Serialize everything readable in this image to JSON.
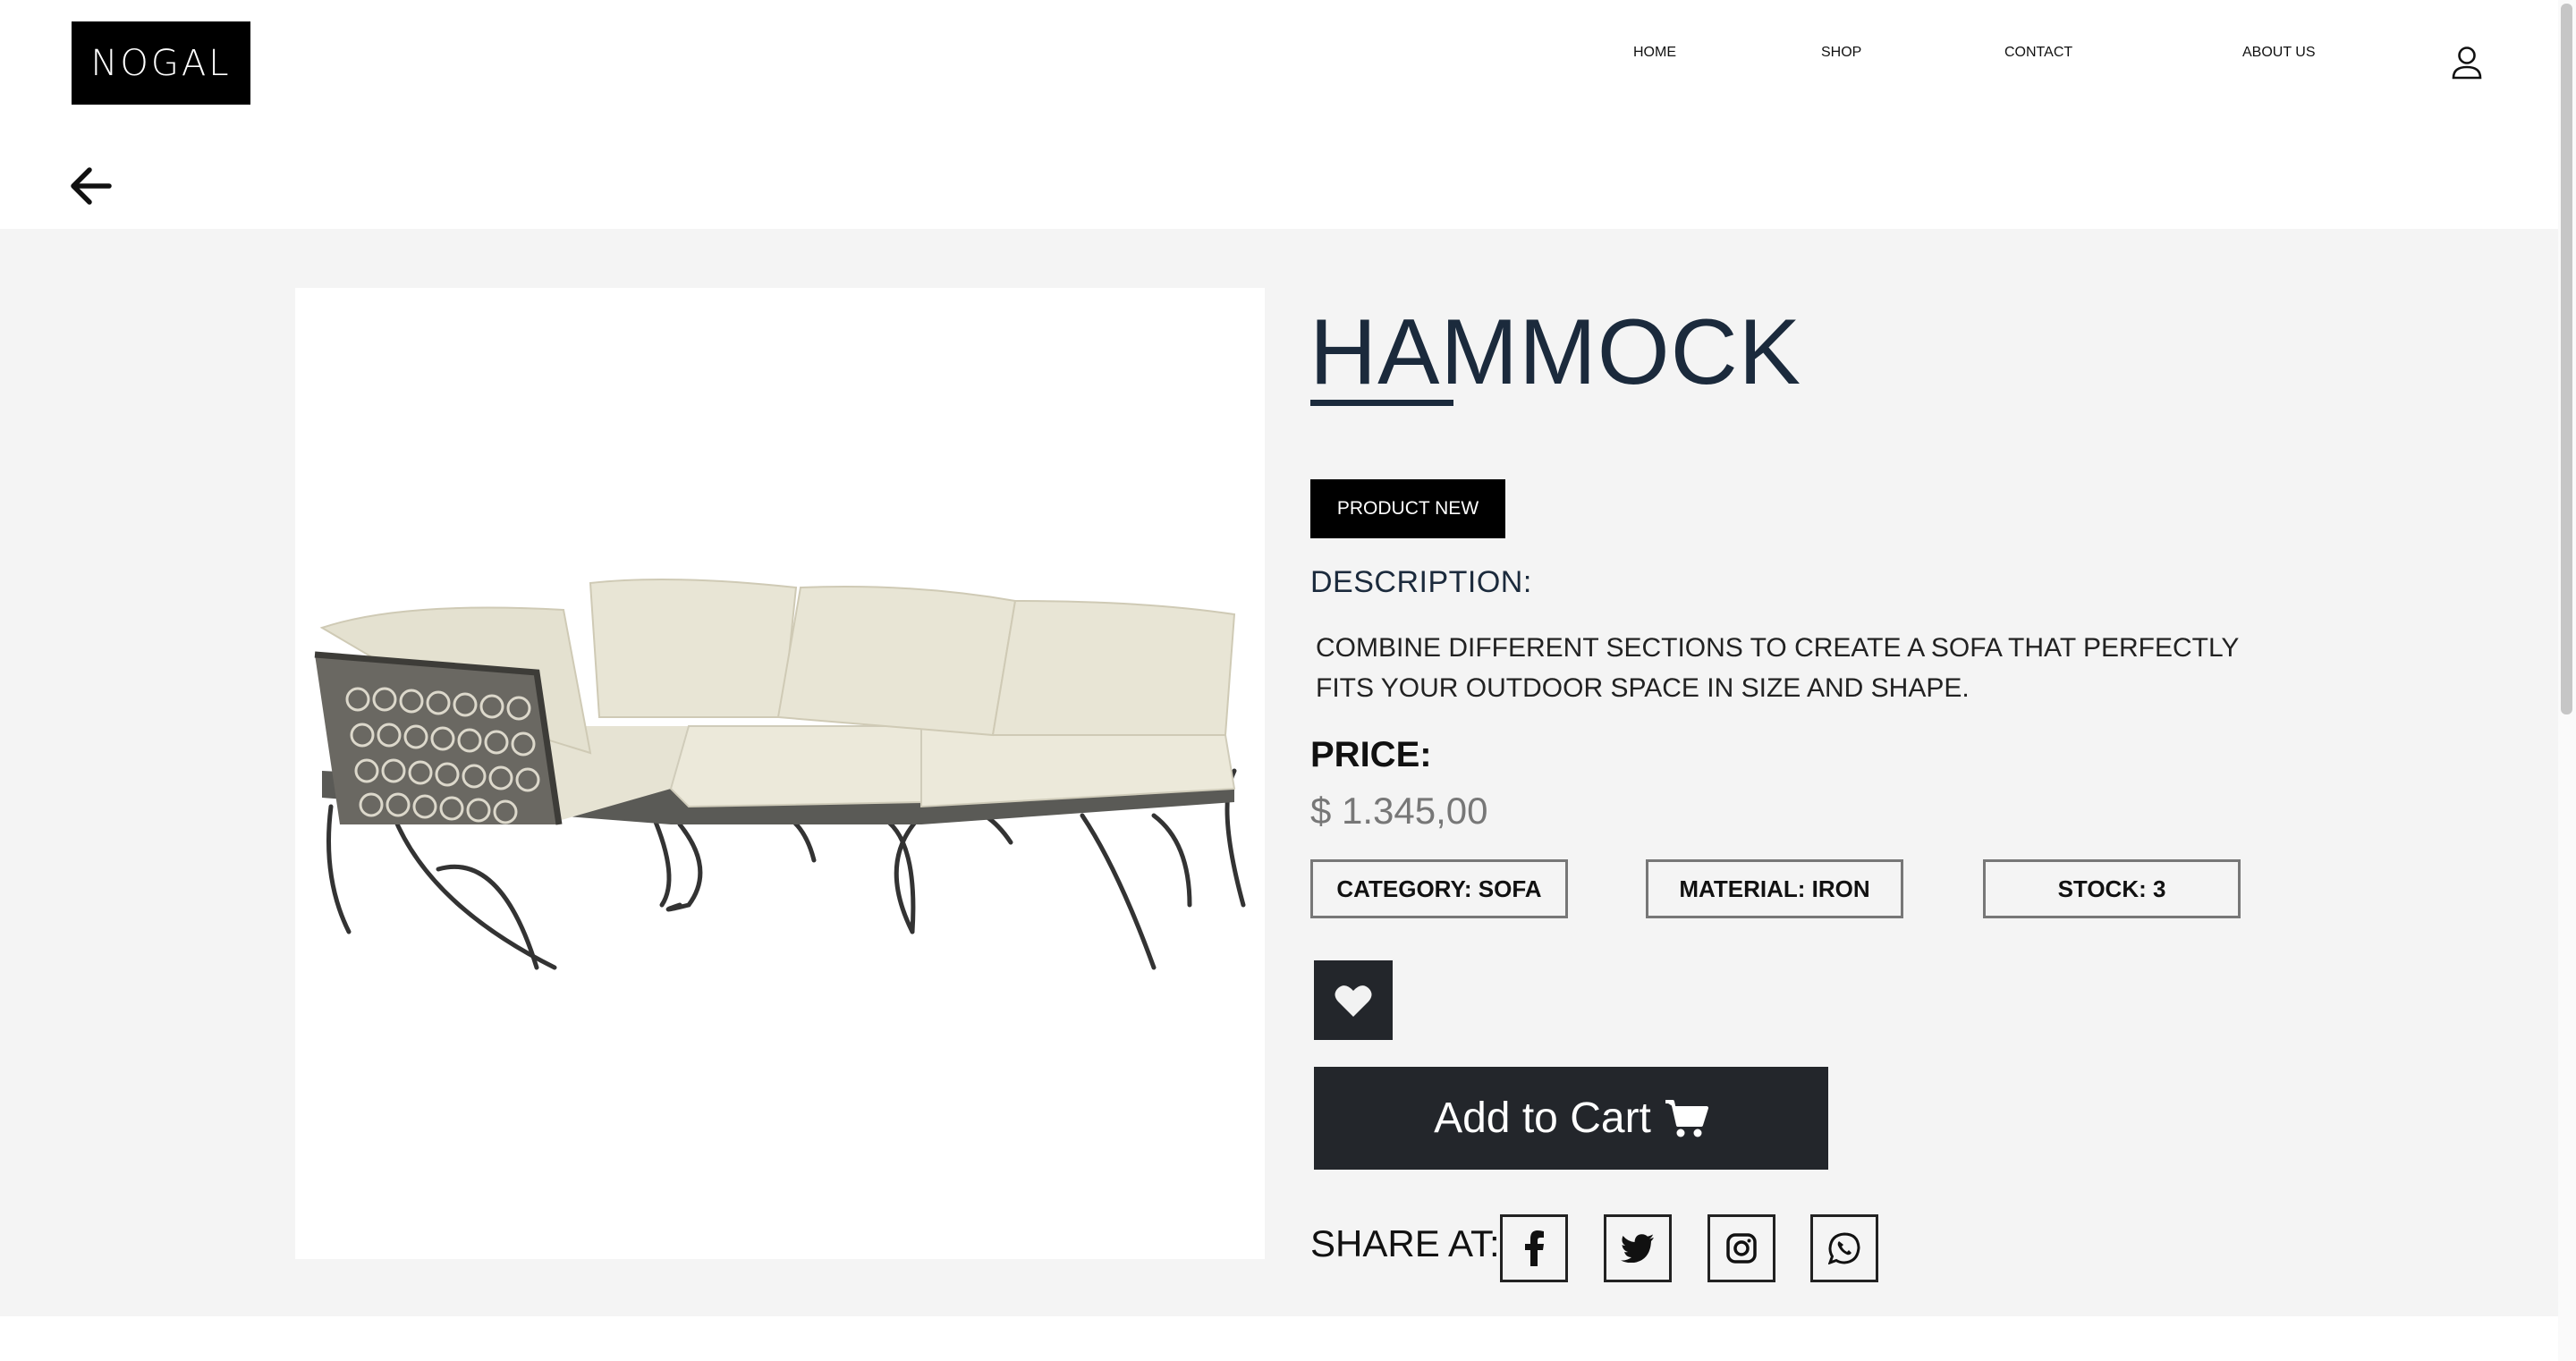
{
  "header": {
    "logo": "NOGAL",
    "nav": [
      "HOME",
      "SHOP",
      "CONTACT",
      "ABOUT US"
    ],
    "user_icon": "user-icon"
  },
  "subbar": {
    "back_icon": "arrow-left-icon"
  },
  "product": {
    "image_icon": "corner-sofa-photo",
    "title": "HAMMOCK",
    "badge": "PRODUCT NEW",
    "description_label": "DESCRIPTION:",
    "description": "COMBINE DIFFERENT SECTIONS TO CREATE A SOFA THAT PERFECTLY FITS YOUR OUTDOOR SPACE IN SIZE AND SHAPE.",
    "price_label": "PRICE:",
    "price": "$ 1.345,00",
    "specs": [
      "CATEGORY: SOFA",
      "MATERIAL: IRON",
      "STOCK: 3"
    ],
    "favorite_icon": "heart-icon",
    "add_to_cart": "Add to Cart",
    "cart_icon": "shopping-cart-icon"
  },
  "share": {
    "label": "SHARE AT:",
    "icons": [
      "facebook-icon",
      "twitter-icon",
      "instagram-icon",
      "whatsapp-icon"
    ]
  },
  "colors": {
    "dark": "#23262b",
    "title": "#1b2a3c",
    "background": "#f4f4f4"
  }
}
